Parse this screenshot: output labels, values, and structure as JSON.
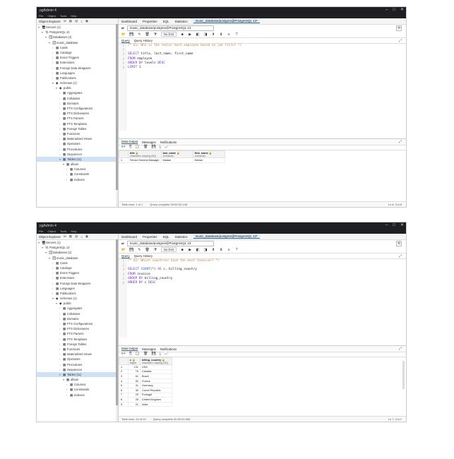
{
  "windows": [
    {
      "title": "pgAdmin 4",
      "menu": [
        "File",
        "Object",
        "Tools",
        "Help"
      ],
      "explorer_title": "Object Explorer",
      "tree": [
        {
          "label": "Servers (1)",
          "indent": 0,
          "arrow": "▾",
          "icon": "🖥"
        },
        {
          "label": "PostgreSQL 13",
          "indent": 1,
          "arrow": "▾",
          "icon": "🐘"
        },
        {
          "label": "Databases (2)",
          "indent": 2,
          "arrow": "▾",
          "icon": "🗄"
        },
        {
          "label": "music_database",
          "indent": 3,
          "arrow": "▾",
          "icon": "🗄"
        },
        {
          "label": "Casts",
          "indent": 4,
          "arrow": "›",
          "icon": "▦"
        },
        {
          "label": "Catalogs",
          "indent": 4,
          "arrow": "›",
          "icon": "▦"
        },
        {
          "label": "Event Triggers",
          "indent": 4,
          "arrow": "›",
          "icon": "▦"
        },
        {
          "label": "Extensions",
          "indent": 4,
          "arrow": "›",
          "icon": "▦"
        },
        {
          "label": "Foreign Data Wrappers",
          "indent": 4,
          "arrow": "›",
          "icon": "▦"
        },
        {
          "label": "Languages",
          "indent": 4,
          "arrow": "›",
          "icon": "▦"
        },
        {
          "label": "Publications",
          "indent": 4,
          "arrow": "›",
          "icon": "▦"
        },
        {
          "label": "Schemas (1)",
          "indent": 4,
          "arrow": "▾",
          "icon": "◆"
        },
        {
          "label": "public",
          "indent": 5,
          "arrow": "▾",
          "icon": "◆"
        },
        {
          "label": "Aggregates",
          "indent": 6,
          "arrow": "›",
          "icon": "▦"
        },
        {
          "label": "Collations",
          "indent": 6,
          "arrow": "›",
          "icon": "▦"
        },
        {
          "label": "Domains",
          "indent": 6,
          "arrow": "›",
          "icon": "▦"
        },
        {
          "label": "FTS Configurations",
          "indent": 6,
          "arrow": "›",
          "icon": "▦"
        },
        {
          "label": "FTS Dictionaries",
          "indent": 6,
          "arrow": "›",
          "icon": "▦"
        },
        {
          "label": "FTS Parsers",
          "indent": 6,
          "arrow": "›",
          "icon": "▦"
        },
        {
          "label": "FTS Templates",
          "indent": 6,
          "arrow": "›",
          "icon": "▦"
        },
        {
          "label": "Foreign Tables",
          "indent": 6,
          "arrow": "›",
          "icon": "▦"
        },
        {
          "label": "Functions",
          "indent": 6,
          "arrow": "›",
          "icon": "▦"
        },
        {
          "label": "Materialized Views",
          "indent": 6,
          "arrow": "›",
          "icon": "▦"
        },
        {
          "label": "Operators",
          "indent": 6,
          "arrow": "›",
          "icon": "▦"
        },
        {
          "label": "Procedures",
          "indent": 6,
          "arrow": "›",
          "icon": "▦"
        },
        {
          "label": "Sequences",
          "indent": 6,
          "arrow": "›",
          "icon": "▦"
        },
        {
          "label": "Tables (11)",
          "indent": 6,
          "arrow": "▾",
          "icon": "▦",
          "selected": true
        },
        {
          "label": "album",
          "indent": 7,
          "arrow": "▾",
          "icon": "▦"
        },
        {
          "label": "Columns",
          "indent": 8,
          "arrow": "›",
          "icon": "▦"
        },
        {
          "label": "Constraints",
          "indent": 8,
          "arrow": "›",
          "icon": "▦"
        },
        {
          "label": "Indexes",
          "indent": 8,
          "arrow": "›",
          "icon": "▦"
        }
      ],
      "tabs": [
        "Dashboard",
        "Properties",
        "SQL",
        "Statistics",
        "music_database/postgres@PostgreSQL 13*"
      ],
      "connection": "music_database/postgres@PostgreSQL 13",
      "limit": "No limit",
      "query_tabs": [
        "Query",
        "Query History"
      ],
      "code": [
        {
          "parts": [
            {
              "t": "/* Q1: Who is the senior most employee based on job title? */",
              "c": "cm"
            }
          ]
        },
        {
          "parts": []
        },
        {
          "parts": [
            {
              "t": "SELECT ",
              "c": "kw"
            },
            {
              "t": "title, last_name, first_name",
              "c": ""
            }
          ]
        },
        {
          "parts": [
            {
              "t": "FROM ",
              "c": "kw"
            },
            {
              "t": "employee",
              "c": ""
            }
          ]
        },
        {
          "parts": [
            {
              "t": "ORDER BY ",
              "c": "kw"
            },
            {
              "t": "levels ",
              "c": ""
            },
            {
              "t": "DESC",
              "c": "kw"
            }
          ]
        },
        {
          "parts": [
            {
              "t": "LIMIT ",
              "c": "kw"
            },
            {
              "t": "1",
              "c": ""
            }
          ]
        }
      ],
      "result_tabs": [
        "Data Output",
        "Messages",
        "Notifications"
      ],
      "columns": [
        {
          "name": "title",
          "type": "character varying (50)"
        },
        {
          "name": "last_name",
          "type": "character"
        },
        {
          "name": "first_name",
          "type": "character"
        }
      ],
      "rows": [
        [
          "1",
          "Senior General Manager",
          "Madan",
          "Mohan"
        ]
      ],
      "status_rows": "Total rows: 1 of 1",
      "status_query": "Query complete 00:00:00.148",
      "status_pos": "Ln 6, Col 8"
    },
    {
      "title": "pgAdmin 4",
      "menu": [
        "File",
        "Object",
        "Tools",
        "Help"
      ],
      "explorer_title": "Object Explorer",
      "tree": [
        {
          "label": "Servers (1)",
          "indent": 0,
          "arrow": "▾",
          "icon": "🖥"
        },
        {
          "label": "PostgreSQL 13",
          "indent": 1,
          "arrow": "▾",
          "icon": "🐘"
        },
        {
          "label": "Databases (2)",
          "indent": 2,
          "arrow": "▾",
          "icon": "🗄"
        },
        {
          "label": "music_database",
          "indent": 3,
          "arrow": "▾",
          "icon": "🗄"
        },
        {
          "label": "Casts",
          "indent": 4,
          "arrow": "›",
          "icon": "▦"
        },
        {
          "label": "Catalogs",
          "indent": 4,
          "arrow": "›",
          "icon": "▦"
        },
        {
          "label": "Event Triggers",
          "indent": 4,
          "arrow": "›",
          "icon": "▦"
        },
        {
          "label": "Extensions",
          "indent": 4,
          "arrow": "›",
          "icon": "▦"
        },
        {
          "label": "Foreign Data Wrappers",
          "indent": 4,
          "arrow": "›",
          "icon": "▦"
        },
        {
          "label": "Languages",
          "indent": 4,
          "arrow": "›",
          "icon": "▦"
        },
        {
          "label": "Publications",
          "indent": 4,
          "arrow": "›",
          "icon": "▦"
        },
        {
          "label": "Schemas (1)",
          "indent": 4,
          "arrow": "▾",
          "icon": "◆"
        },
        {
          "label": "public",
          "indent": 5,
          "arrow": "▾",
          "icon": "◆"
        },
        {
          "label": "Aggregates",
          "indent": 6,
          "arrow": "›",
          "icon": "▦"
        },
        {
          "label": "Collations",
          "indent": 6,
          "arrow": "›",
          "icon": "▦"
        },
        {
          "label": "Domains",
          "indent": 6,
          "arrow": "›",
          "icon": "▦"
        },
        {
          "label": "FTS Configurations",
          "indent": 6,
          "arrow": "›",
          "icon": "▦"
        },
        {
          "label": "FTS Dictionaries",
          "indent": 6,
          "arrow": "›",
          "icon": "▦"
        },
        {
          "label": "FTS Parsers",
          "indent": 6,
          "arrow": "›",
          "icon": "▦"
        },
        {
          "label": "FTS Templates",
          "indent": 6,
          "arrow": "›",
          "icon": "▦"
        },
        {
          "label": "Foreign Tables",
          "indent": 6,
          "arrow": "›",
          "icon": "▦"
        },
        {
          "label": "Functions",
          "indent": 6,
          "arrow": "›",
          "icon": "▦"
        },
        {
          "label": "Materialized Views",
          "indent": 6,
          "arrow": "›",
          "icon": "▦"
        },
        {
          "label": "Operators",
          "indent": 6,
          "arrow": "›",
          "icon": "▦"
        },
        {
          "label": "Procedures",
          "indent": 6,
          "arrow": "›",
          "icon": "▦"
        },
        {
          "label": "Sequences",
          "indent": 6,
          "arrow": "›",
          "icon": "▦"
        },
        {
          "label": "Tables (11)",
          "indent": 6,
          "arrow": "▾",
          "icon": "▦",
          "selected": true
        },
        {
          "label": "album",
          "indent": 7,
          "arrow": "▾",
          "icon": "▦"
        },
        {
          "label": "Columns",
          "indent": 8,
          "arrow": "›",
          "icon": "▦"
        },
        {
          "label": "Constraints",
          "indent": 8,
          "arrow": "›",
          "icon": "▦"
        },
        {
          "label": "Indexes",
          "indent": 8,
          "arrow": "›",
          "icon": "▦"
        }
      ],
      "tabs": [
        "Dashboard",
        "Properties",
        "SQL",
        "Statistics",
        "music_database/postgres@PostgreSQL 13*"
      ],
      "connection": "music_database/postgres@PostgreSQL 13",
      "limit": "No limit",
      "query_tabs": [
        "Query",
        "Query History"
      ],
      "code": [
        {
          "parts": [
            {
              "t": "/* Q2: Which countries have the most Invoices? */",
              "c": "cm"
            }
          ]
        },
        {
          "parts": []
        },
        {
          "parts": [
            {
              "t": "SELECT ",
              "c": "kw"
            },
            {
              "t": "COUNT",
              "c": "fn"
            },
            {
              "t": "(*) ",
              "c": ""
            },
            {
              "t": "AS ",
              "c": "kw"
            },
            {
              "t": "c, billing_country",
              "c": ""
            }
          ]
        },
        {
          "parts": [
            {
              "t": "FROM ",
              "c": "kw"
            },
            {
              "t": "invoice",
              "c": ""
            }
          ]
        },
        {
          "parts": [
            {
              "t": "GROUP BY ",
              "c": "kw"
            },
            {
              "t": "billing_country",
              "c": ""
            }
          ]
        },
        {
          "parts": [
            {
              "t": "ORDER BY ",
              "c": "kw"
            },
            {
              "t": "c ",
              "c": ""
            },
            {
              "t": "DESC",
              "c": "kw"
            }
          ]
        }
      ],
      "result_tabs": [
        "Data Output",
        "Messages",
        "Notifications"
      ],
      "columns": [
        {
          "name": "c",
          "type": "bigint"
        },
        {
          "name": "billing_country",
          "type": "character varying (30)"
        }
      ],
      "rows": [
        [
          "1",
          "131",
          "USA"
        ],
        [
          "2",
          "76",
          "Canada"
        ],
        [
          "3",
          "61",
          "Brazil"
        ],
        [
          "4",
          "50",
          "France"
        ],
        [
          "5",
          "41",
          "Germany"
        ],
        [
          "6",
          "30",
          "Czech Republic"
        ],
        [
          "7",
          "29",
          "Portugal"
        ],
        [
          "8",
          "28",
          "United Kingdom"
        ],
        [
          "9",
          "21",
          "India"
        ]
      ],
      "status_rows": "Total rows: 24 of 24",
      "status_query": "Query complete 00:00:00.069",
      "status_pos": "Ln 7, Col 1"
    }
  ]
}
